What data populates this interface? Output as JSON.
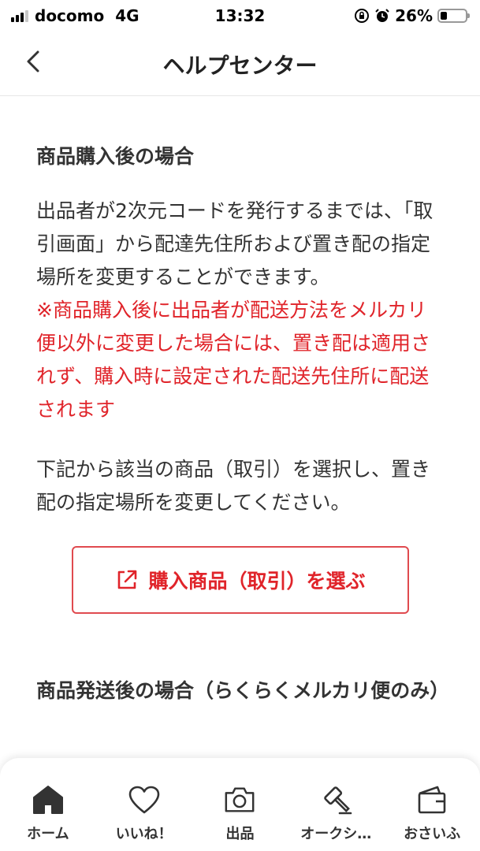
{
  "status_bar": {
    "carrier": "docomo",
    "network": "4G",
    "time": "13:32",
    "battery": "26%",
    "battery_level": 0.26,
    "signal_bars": 3,
    "signal_total": 4
  },
  "header": {
    "title": "ヘルプセンター"
  },
  "content": {
    "section1_heading": "商品購入後の場合",
    "section1_body": "出品者が2次元コードを発行するまでは、「取引画面」から配達先住所および置き配の指定場所を変更することができます。",
    "section1_warning": "※商品購入後に出品者が配送方法をメルカリ便以外に変更した場合には、置き配は適用されず、購入時に設定された配送先住所に配送されます",
    "section1_select_text": "下記から該当の商品（取引）を選択し、置き配の指定場所を変更してください。",
    "select_button_label": "購入商品（取引）を選ぶ",
    "section2_heading": "商品発送後の場合（らくらくメルカリ便のみ）"
  },
  "tabs": [
    {
      "label": "ホーム",
      "icon": "home-icon",
      "active": true
    },
    {
      "label": "いいね！",
      "icon": "heart-icon",
      "active": false
    },
    {
      "label": "出品",
      "icon": "camera-icon",
      "active": false
    },
    {
      "label": "オークシ…",
      "icon": "gavel-icon",
      "active": false
    },
    {
      "label": "おさいふ",
      "icon": "wallet-icon",
      "active": false
    }
  ],
  "colors": {
    "accent_red": "#e0242a",
    "text": "#333333"
  }
}
